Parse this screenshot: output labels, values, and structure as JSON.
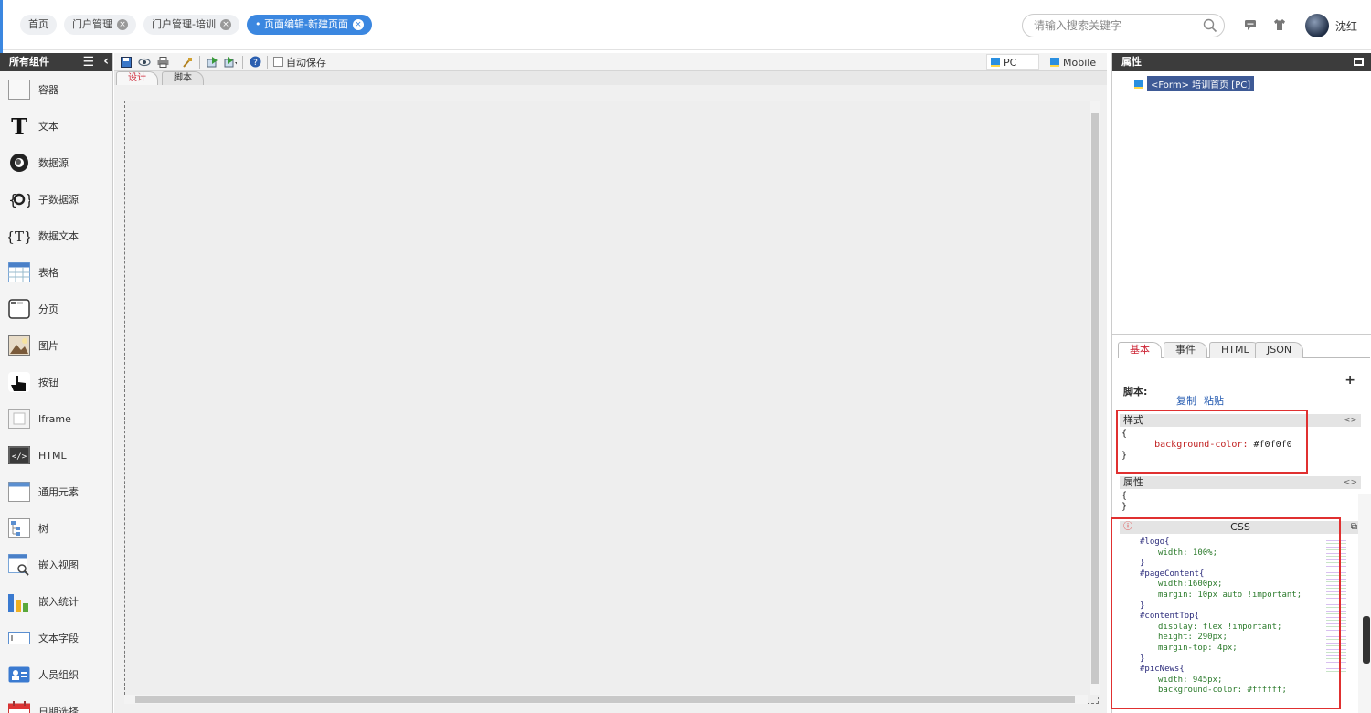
{
  "header": {
    "tabs": [
      {
        "label": "首页",
        "closable": false
      },
      {
        "label": "门户管理",
        "closable": true
      },
      {
        "label": "门户管理-培训",
        "closable": true
      },
      {
        "label": "页面编辑-新建页面",
        "closable": true,
        "active": true
      }
    ],
    "search_placeholder": "请输入搜索关键字",
    "username": "沈红"
  },
  "components": {
    "title": "所有组件",
    "items": [
      {
        "label": "容器",
        "icon": "container-icon"
      },
      {
        "label": "文本",
        "icon": "text-icon"
      },
      {
        "label": "数据源",
        "icon": "datasource-icon"
      },
      {
        "label": "子数据源",
        "icon": "sub-datasource-icon"
      },
      {
        "label": "数据文本",
        "icon": "data-text-icon"
      },
      {
        "label": "表格",
        "icon": "table-icon"
      },
      {
        "label": "分页",
        "icon": "pagination-icon"
      },
      {
        "label": "图片",
        "icon": "image-icon"
      },
      {
        "label": "按钮",
        "icon": "button-icon"
      },
      {
        "label": "Iframe",
        "icon": "iframe-icon"
      },
      {
        "label": "HTML",
        "icon": "html-icon"
      },
      {
        "label": "通用元素",
        "icon": "generic-element-icon"
      },
      {
        "label": "树",
        "icon": "tree-icon"
      },
      {
        "label": "嵌入视图",
        "icon": "embed-view-icon"
      },
      {
        "label": "嵌入统计",
        "icon": "embed-stats-icon"
      },
      {
        "label": "文本字段",
        "icon": "text-field-icon"
      },
      {
        "label": "人员组织",
        "icon": "org-icon"
      },
      {
        "label": "日期选择",
        "icon": "calendar-icon"
      }
    ]
  },
  "editor": {
    "autosave_label": "自动保存",
    "pc_label": "PC",
    "mobile_label": "Mobile",
    "tabs": [
      "设计",
      "脚本"
    ]
  },
  "properties": {
    "title": "属性",
    "tree_node": "<Form> 培训首页 [PC]",
    "tabs": [
      "基本",
      "事件",
      "HTML",
      "JSON"
    ],
    "script_label": "脚本:",
    "copy_link": "复制",
    "paste_link": "粘贴",
    "style_label": "样式",
    "style_open": "{",
    "style_property": "background-color:",
    "style_value": "#f0f0f0",
    "style_close": "}",
    "attr_label": "属性",
    "attr_open": "{",
    "attr_close": "}",
    "css_label": "CSS",
    "css_lines": [
      {
        "t": "#logo{",
        "c": "sel"
      },
      {
        "t": "width: 100%;",
        "c": "prop"
      },
      {
        "t": "}",
        "c": "sel"
      },
      {
        "t": "#pageContent{",
        "c": "sel"
      },
      {
        "t": "width:1600px;",
        "c": "prop"
      },
      {
        "t": "margin: 10px auto !important;",
        "c": "prop"
      },
      {
        "t": "}",
        "c": "sel"
      },
      {
        "t": "#contentTop{",
        "c": "sel"
      },
      {
        "t": "display: flex !important;",
        "c": "prop"
      },
      {
        "t": "height: 290px;",
        "c": "prop"
      },
      {
        "t": "margin-top: 4px;",
        "c": "prop"
      },
      {
        "t": "}",
        "c": "sel"
      },
      {
        "t": "#picNews{",
        "c": "sel"
      },
      {
        "t": "width: 945px;",
        "c": "prop"
      },
      {
        "t": "background-color: #ffffff;",
        "c": "prop"
      }
    ]
  },
  "colors": {
    "accent": "#3b87e0",
    "highlight_box": "#e03030",
    "panel_header": "#3c3c3c"
  }
}
